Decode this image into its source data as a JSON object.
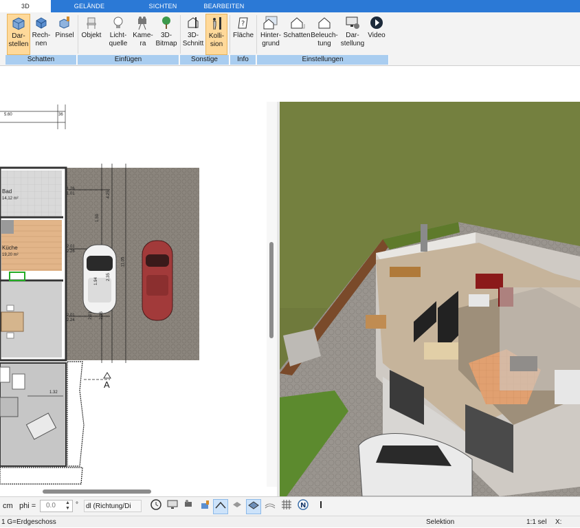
{
  "tabs": [
    {
      "label": "3D",
      "active": true
    },
    {
      "label": "GELÄNDE"
    },
    {
      "label": "SICHTEN"
    },
    {
      "label": "BEARBEITEN"
    }
  ],
  "ribbon": {
    "buttons": {
      "darstellen": "Dar-\nstellen",
      "rechnen": "Rech-\nnen",
      "pinsel": "Pinsel",
      "objekt": "Objekt",
      "lichtquelle": "Licht-\nquelle",
      "kamera": "Kame-\nra",
      "bitmap": "3D-\nBitmap",
      "schnitt": "3D-\nSchnitt",
      "kollision": "Kolli-\nsion",
      "flaeche": "Fläche",
      "hintergrund": "Hinter-\ngrund",
      "schatten": "Schatten",
      "beleuchtung": "Beleuch-\ntung",
      "darstellung": "Dar-\nstellung",
      "video": "Video"
    },
    "groups": {
      "schatten": "Schatten",
      "einfuegen": "Einfügen",
      "sonstige": "Sonstige",
      "info": "Info",
      "einstellungen": "Einstellungen"
    }
  },
  "plan": {
    "rooms": {
      "bad": {
        "name": "Bad",
        "area": "14,12 m²"
      },
      "kueche": {
        "name": "Küche",
        "area": "19,20 m²"
      }
    },
    "dims": {
      "top": "5.60",
      "top_right": "36",
      "d1": "1.26",
      "d2": "1.01",
      "d3": "2.01",
      "d4": "2.26",
      "d5": "2.01",
      "d6": "2.24",
      "d7": "1.32",
      "d8": "4.25",
      "d9": "2.35",
      "d10": "1.59",
      "d11": "11.05",
      "d12": "1.94",
      "d13": "2.01",
      "d14": "2.36"
    },
    "section_marker": "A"
  },
  "toolbar2": {
    "unit": "cm",
    "phi_label": "phi =",
    "phi_value": "0.0",
    "degree": "°",
    "direction": "dl (Richtung/Di"
  },
  "status": {
    "floor": "1 G=Erdgeschoss",
    "mode": "Selektion",
    "scale": "1:1 sel",
    "x_label": "X:"
  },
  "colors": {
    "tab_blue": "#2b79d6",
    "group_blue": "#a9cdf0",
    "selected": "#ffd99a",
    "grass": "#6f7a3c"
  }
}
